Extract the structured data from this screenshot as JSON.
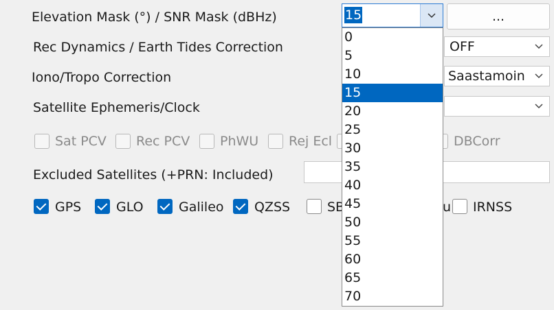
{
  "rows": {
    "elev_label": "Elevation Mask (°) / SNR Mask (dBHz)",
    "dyn_label": "Rec Dynamics / Earth Tides Correction",
    "iono_label": "Iono/Tropo Correction",
    "eph_label": "Satellite Ephemeris/Clock",
    "excl_label": "Excluded Satellites (+PRN: Included)"
  },
  "elevation": {
    "selected": "15",
    "options": [
      "0",
      "5",
      "10",
      "15",
      "20",
      "25",
      "30",
      "35",
      "40",
      "45",
      "50",
      "55",
      "60",
      "65",
      "70"
    ]
  },
  "snr_button": {
    "label": "..."
  },
  "tides_combo": {
    "value": "OFF"
  },
  "tropo_combo": {
    "value": "Saastamoin"
  },
  "eph_combo": {
    "value": ""
  },
  "corrections": {
    "sat_pcv": "Sat PCV",
    "rec_pcv": "Rec PCV",
    "phwu": "PhWU",
    "rej_ecl": "Rej Ecl",
    "dbcorr": "DBCorr"
  },
  "excluded_satellites": {
    "value": ""
  },
  "systems": {
    "gps": "GPS",
    "glo": "GLO",
    "galileo": "Galileo",
    "qzss": "QZSS",
    "sbas": "SB",
    "beidou": "u",
    "irnss": "IRNSS"
  },
  "icons": {
    "dropdown_arrow": "chevron-down-icon",
    "check": "check-icon"
  },
  "colors": {
    "accent": "#0067c0",
    "background": "#f0f0f0"
  }
}
